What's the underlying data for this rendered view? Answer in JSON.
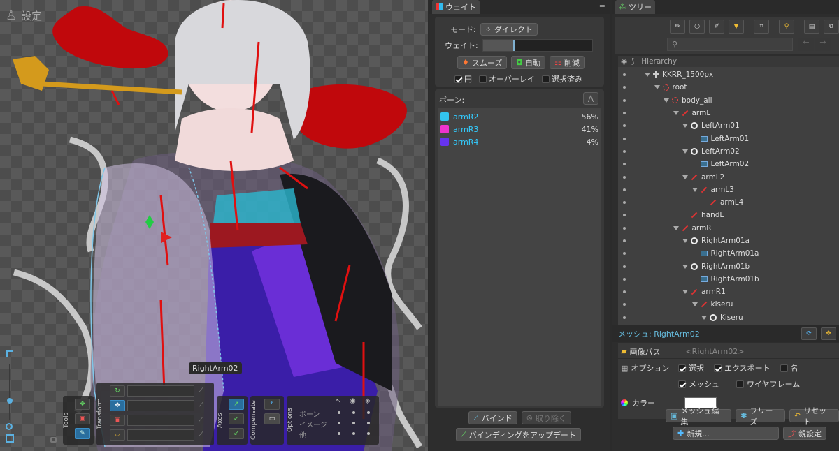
{
  "viewport": {
    "settings_label": "設定",
    "hover_label": "RightArm02",
    "tool_groups": {
      "tools": "Tools",
      "transform": "Transform",
      "axes": "Axes",
      "compensate": "Compensate",
      "options": "Options"
    },
    "options_rows": [
      "ボーン",
      "イメージ",
      "他"
    ]
  },
  "weight_panel": {
    "title": "ウェイト",
    "mode_label": "モード:",
    "mode_value": "ダイレクト",
    "weight_label": "ウェイト:",
    "weight_fraction": 0.28,
    "buttons": {
      "smooth": "スムーズ",
      "auto": "自動",
      "reduce": "削減"
    },
    "checks": [
      {
        "label": "円",
        "checked": true
      },
      {
        "label": "オーバーレイ",
        "checked": false
      },
      {
        "label": "選択済み",
        "checked": false
      }
    ],
    "bones_label": "ボーン:",
    "bones": [
      {
        "name": "armR2",
        "percent": "56%",
        "color": "#33c4ee"
      },
      {
        "name": "armR3",
        "percent": "41%",
        "color": "#ee33cc"
      },
      {
        "name": "armR4",
        "percent": "4%",
        "color": "#6633ee"
      }
    ],
    "bind_button": "バインド",
    "remove_button": "取り除く",
    "update_button": "バインディングをアップデート"
  },
  "tree_panel": {
    "title": "ツリー",
    "hierarchy_label": "Hierarchy",
    "nodes": [
      {
        "label": "KKRR_1500px",
        "icon": "skeleton-icon",
        "depth": 0,
        "expanded": true
      },
      {
        "label": "root",
        "icon": "root-icon",
        "depth": 1,
        "expanded": true
      },
      {
        "label": "body_all",
        "icon": "root-icon",
        "depth": 2,
        "expanded": true
      },
      {
        "label": "armL",
        "icon": "bone-icon",
        "depth": 3,
        "expanded": true
      },
      {
        "label": "LeftArm01",
        "icon": "slot-icon",
        "depth": 4,
        "expanded": true
      },
      {
        "label": "LeftArm01",
        "icon": "mesh-icon",
        "depth": 5,
        "expanded": false
      },
      {
        "label": "LeftArm02",
        "icon": "slot-icon",
        "depth": 4,
        "expanded": true
      },
      {
        "label": "LeftArm02",
        "icon": "mesh-icon",
        "depth": 5,
        "expanded": false
      },
      {
        "label": "armL2",
        "icon": "bone-icon",
        "depth": 4,
        "expanded": true
      },
      {
        "label": "armL3",
        "icon": "bone-icon",
        "depth": 5,
        "expanded": true
      },
      {
        "label": "armL4",
        "icon": "bone-icon",
        "depth": 6,
        "expanded": false
      },
      {
        "label": "handL",
        "icon": "bone-icon",
        "depth": 4,
        "expanded": false
      },
      {
        "label": "armR",
        "icon": "bone-icon",
        "depth": 3,
        "expanded": true
      },
      {
        "label": "RightArm01a",
        "icon": "slot-icon",
        "depth": 4,
        "expanded": true
      },
      {
        "label": "RightArm01a",
        "icon": "mesh-icon",
        "depth": 5,
        "expanded": false
      },
      {
        "label": "RightArm01b",
        "icon": "slot-icon",
        "depth": 4,
        "expanded": true
      },
      {
        "label": "RightArm01b",
        "icon": "mesh-icon",
        "depth": 5,
        "expanded": false
      },
      {
        "label": "armR1",
        "icon": "bone-icon",
        "depth": 4,
        "expanded": true
      },
      {
        "label": "kiseru",
        "icon": "bone-icon",
        "depth": 5,
        "expanded": true
      },
      {
        "label": "Kiseru",
        "icon": "slot-icon",
        "depth": 6,
        "expanded": true
      }
    ]
  },
  "mesh_props": {
    "title": "メッシュ: RightArm02",
    "image_path_label": "画像パス",
    "image_path_value": "<RightArm02>",
    "options_label": "オプション",
    "options": [
      {
        "label": "選択",
        "checked": true
      },
      {
        "label": "エクスポート",
        "checked": true
      },
      {
        "label": "名",
        "checked": false
      },
      {
        "label": "メッシュ",
        "checked": true
      },
      {
        "label": "ワイヤフレーム",
        "checked": false
      }
    ],
    "color_label": "カラー",
    "color_value": "#ffffff",
    "buttons": {
      "edit_mesh": "メッシュ編集",
      "freeze": "フリーズ",
      "reset": "リセット",
      "new": "新規...",
      "set_parent": "親設定"
    }
  }
}
